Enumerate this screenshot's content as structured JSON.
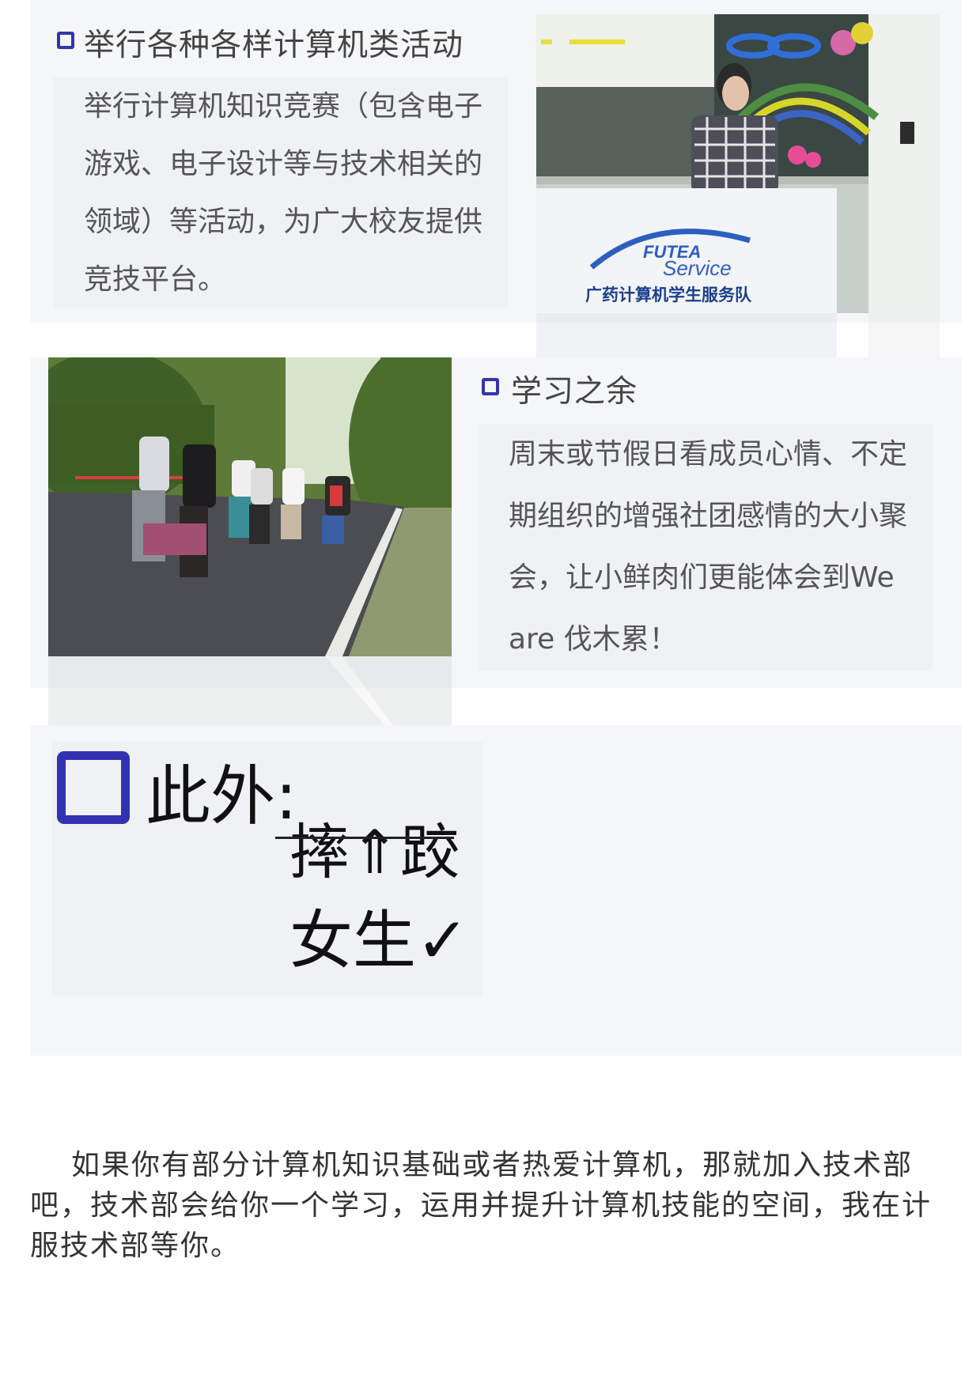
{
  "section_activities": {
    "heading": "举行各种各样计算机类活动",
    "body": "举行计算机知识竞赛（包含电子游戏、电子设计等与技术相关的领域）等活动，为广大校友提供竞技平台。",
    "banner": {
      "line1": "FUTEA",
      "line2": "Service",
      "line3": "广药计算机学生服务队"
    }
  },
  "section_leisure": {
    "heading": "学习之余",
    "body": "周末或节假日看成员心情、不定期组织的增强社团感情的大小聚会，让小鲜肉们更能体会到We are 伐木累！"
  },
  "section_extra": {
    "heading": "此外:",
    "crossed_out": "摔⇑跤",
    "answer": "女生✓"
  },
  "outro": "如果你有部分计算机知识基础或者热爱计算机，那就加入技术部吧，技术部会给你一个学习，运用并提升计算机技能的空间，我在计服技术部等你。",
  "colors": {
    "accent": "#3535a8",
    "panel": "#f5f6f8"
  }
}
